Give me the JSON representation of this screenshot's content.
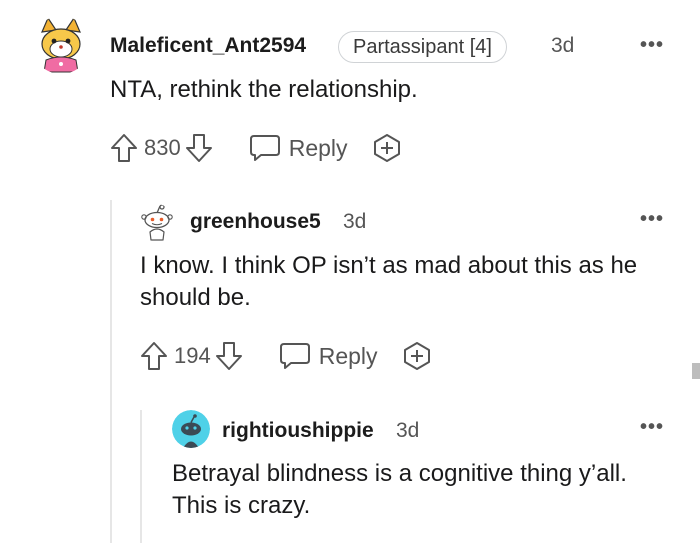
{
  "comments": [
    {
      "username": "Maleficent_Ant2594",
      "flair": "Partassipant [4]",
      "time": "3d",
      "text": "NTA, rethink the relationship.",
      "score": "830",
      "reply_label": "Reply"
    },
    {
      "username": "greenhouse5",
      "time": "3d",
      "text": "I know. I think OP isn’t as mad about this as he should be.",
      "score": "194",
      "reply_label": "Reply"
    },
    {
      "username": "rightioushippie",
      "time": "3d",
      "text": "Betrayal blindness is a cognitive thing y’all. This is crazy."
    }
  ],
  "more_glyph": "•••",
  "icons": {
    "upvote": "upvote-arrow",
    "downvote": "downvote-arrow",
    "reply": "speech-bubble",
    "award": "plus-in-circle"
  },
  "colors": {
    "text": "#1a1a1b",
    "meta": "#555555",
    "thread_line": "#e6e6e6",
    "avatar3_bg": "#4fd1e8"
  }
}
